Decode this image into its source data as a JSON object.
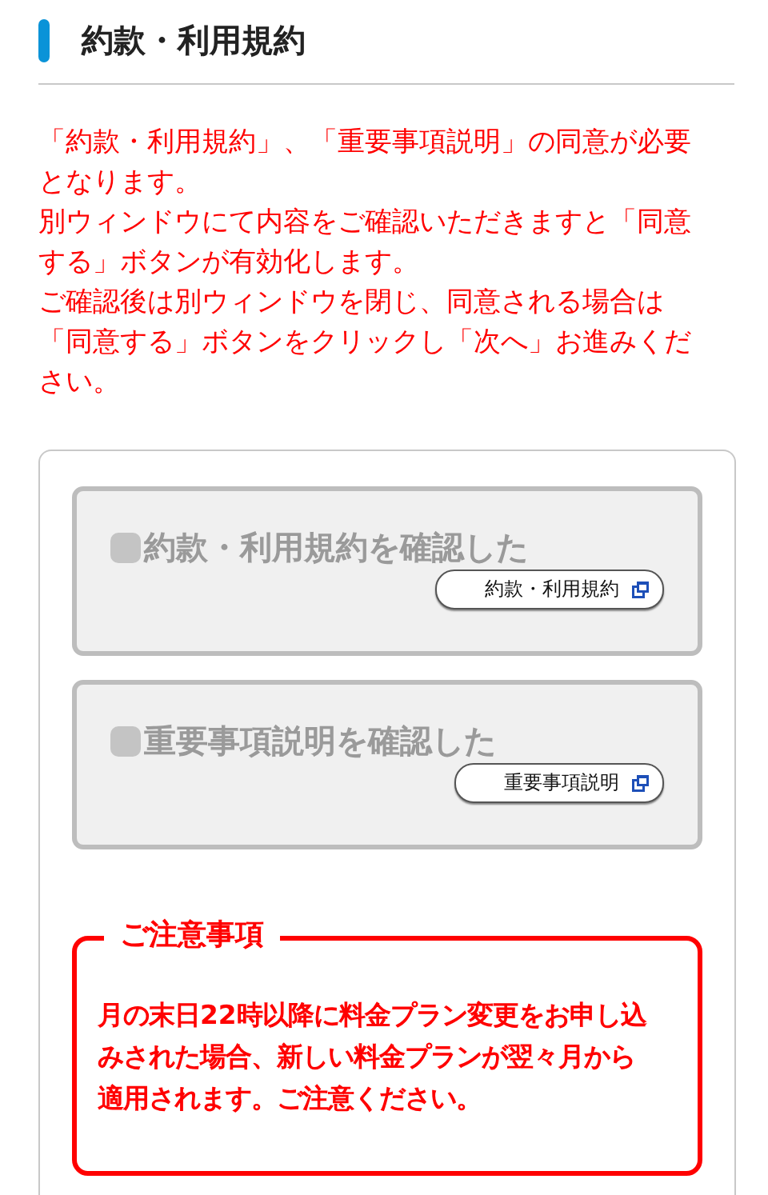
{
  "heading": {
    "title": "約款・利用規約"
  },
  "instructions": [
    "「約款・利用規約」、「重要事項説明」の同意が必要となります。",
    "別ウィンドウにて内容をご確認いただきますと「同意する」ボタンが有効化します。",
    "ご確認後は別ウィンドウを閉じ、同意される場合は「同意する」ボタンをクリックし「次へ」お進みください。"
  ],
  "agreements": [
    {
      "label": "約款・利用規約を確認した",
      "checked": false,
      "disabled": true,
      "link": "約款・利用規約"
    },
    {
      "label": "重要事項説明を確認した",
      "checked": false,
      "disabled": true,
      "link": "重要事項説明"
    }
  ],
  "notice": {
    "title": "ご注意事項",
    "text": "月の末日22時以降に料金プラン変更をお申し込みされた場合、新しい料金プランが翌々月から適用されます。ご注意ください。"
  }
}
